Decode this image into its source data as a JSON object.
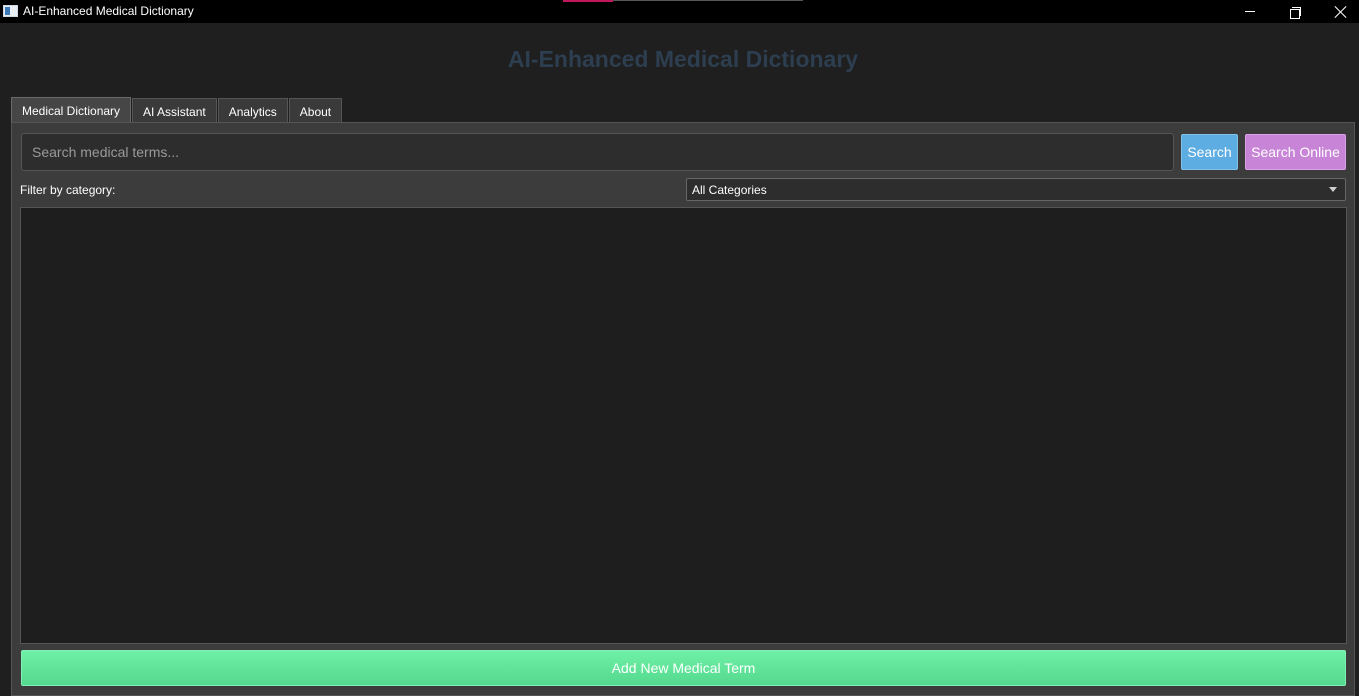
{
  "window": {
    "title": "AI-Enhanced Medical Dictionary",
    "minimize_icon": "minimize-icon",
    "restore_icon": "restore-icon",
    "close_icon": "close-icon"
  },
  "header": {
    "heading": "AI-Enhanced Medical Dictionary",
    "heading_color": "#2c3e50"
  },
  "tabs": [
    {
      "label": "Medical Dictionary",
      "active": true
    },
    {
      "label": "AI Assistant",
      "active": false
    },
    {
      "label": "Analytics",
      "active": false
    },
    {
      "label": "About",
      "active": false
    }
  ],
  "search": {
    "placeholder": "Search medical terms...",
    "value": "",
    "search_label": "Search",
    "search_online_label": "Search Online"
  },
  "filter": {
    "label": "Filter by category:",
    "selected": "All Categories"
  },
  "results": {
    "items": []
  },
  "actions": {
    "add_term_label": "Add New Medical Term"
  },
  "colors": {
    "search_button": "#5dade2",
    "search_online_button": "#c884d6",
    "add_button": "#5fe39a",
    "background": "#1f1f1f"
  }
}
